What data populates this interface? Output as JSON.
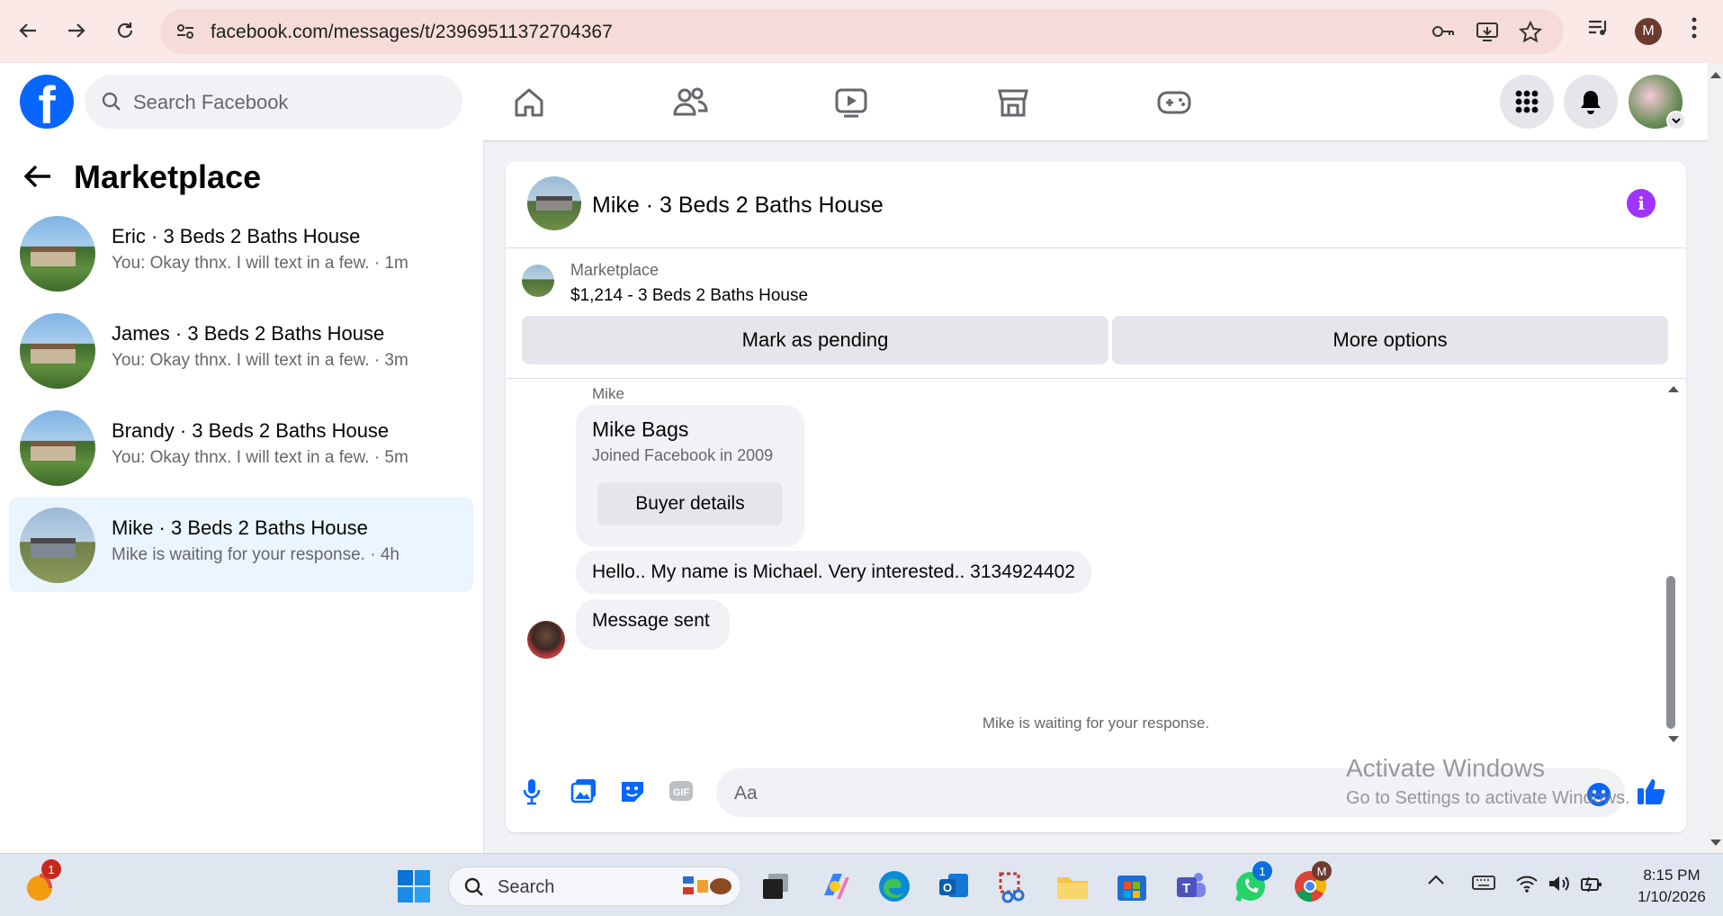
{
  "browser": {
    "url": "facebook.com/messages/t/23969511372704367",
    "profile_initial": "M"
  },
  "header": {
    "search_placeholder": "Search Facebook",
    "logo_letter": "f"
  },
  "sidebar": {
    "title": "Marketplace",
    "conversations": [
      {
        "name": "Eric · 3 Beds 2 Baths House",
        "preview": "You: Okay thnx. I will text in a few. · 1m",
        "active": false
      },
      {
        "name": "James · 3 Beds 2 Baths House",
        "preview": "You: Okay thnx. I will text in a few. · 3m",
        "active": false
      },
      {
        "name": "Brandy · 3 Beds 2 Baths House",
        "preview": "You: Okay thnx. I will text in a few. · 5m",
        "active": false
      },
      {
        "name": "Mike · 3 Beds 2 Baths House",
        "preview": "Mike is waiting for your response. · 4h",
        "active": true
      }
    ]
  },
  "chat": {
    "title": "Mike · 3 Beds 2 Baths House",
    "listing_category": "Marketplace",
    "listing_price_title": "$1,214 - 3 Beds 2 Baths House",
    "mark_pending_label": "Mark as pending",
    "more_options_label": "More options",
    "sender_label": "Mike",
    "buyer_name": "Mike Bags",
    "buyer_joined": "Joined Facebook in 2009",
    "buyer_details_label": "Buyer details",
    "message_1": "Hello.. My name is Michael. Very interested.. 3134924402",
    "message_2": "Message sent",
    "waiting_text": "Mike is waiting for your response.",
    "composer_placeholder": "Aa"
  },
  "watermark": {
    "line1": "Activate Windows",
    "line2": "Go to Settings to activate Windows."
  },
  "taskbar": {
    "search_placeholder": "Search",
    "time": "8:15 PM",
    "date": "1/10/2026",
    "notification_count": "1",
    "whatsapp_count": "1",
    "chrome_profile": "M"
  },
  "colors": {
    "facebook_blue": "#0866ff",
    "info_purple": "#a033ff",
    "active_conversation_bg": "#ebf5ff"
  }
}
